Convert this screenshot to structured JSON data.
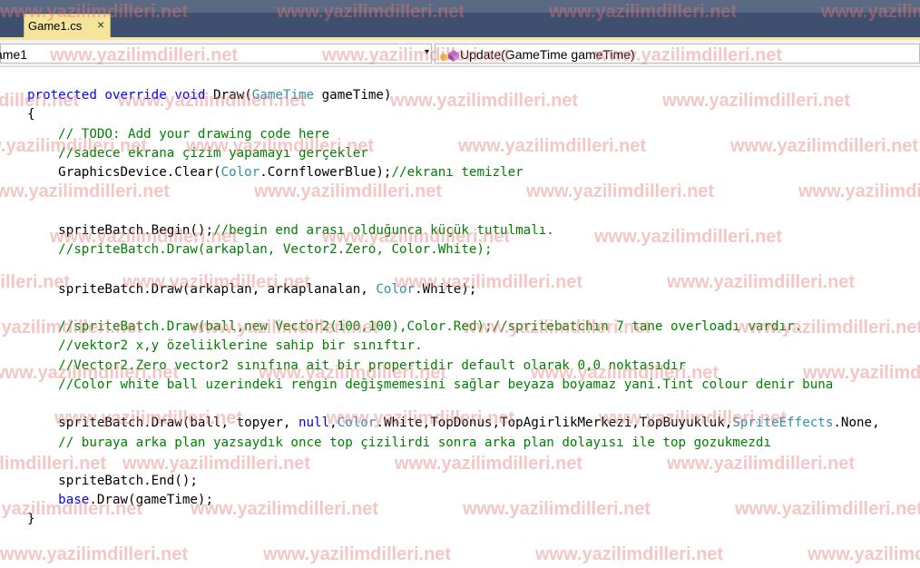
{
  "editor": {
    "tab": {
      "title": "Game1.cs",
      "close": "×"
    },
    "nav": {
      "left_value": "ame1",
      "left_arrow": "▾",
      "right_value": "Update(GameTime gameTime)"
    }
  },
  "code": {
    "l1": {
      "a": "protected",
      "b": " ",
      "c": "override",
      "d": " ",
      "e": "void",
      "f": " Draw(",
      "g": "GameTime",
      "h": " gameTime)"
    },
    "l2": "{",
    "l3": "    // TODO: Add your drawing code here",
    "l4": "    //sadece ekrana çizim yapamayı gerçekler",
    "l5": {
      "a": "    GraphicsDevice.Clear(",
      "b": "Color",
      "c": ".CornflowerBlue);",
      "d": "//ekranı temizler"
    },
    "l6": {
      "a": "    spriteBatch.Begin();",
      "b": "//begin end arası olduğunca küçük tutulmalı."
    },
    "l7": "    //spriteBatch.Draw(arkaplan, Vector2.Zero, Color.White);",
    "l8": {
      "a": "    spriteBatch.Draw(arkaplan, arkaplanalan, ",
      "b": "Color",
      "c": ".White);"
    },
    "l9": "    //spriteBatch.Draw(ball,new Vector2(100,100),Color.Red);//spritebatchın 7 tane overloadı vardır.",
    "l10": "    //vektor2 x,y özeliiklerine sahip bir sınıftır.",
    "l11": "    //Vector2.Zero vector2 sınıfına ait bir propertidir default olarak 0,0 noktasıdır",
    "l12": "    //Color white ball uzerindeki rengin değişmemesini sağlar beyaza boyamaz yani.Tint colour denir buna",
    "l13": {
      "a": "    spriteBatch.Draw(ball, topyer, ",
      "b": "null",
      "c": ",",
      "d": "Color",
      "e": ".White,TopDonus,TopAgirlikMerkezi,TopBuyukluk,",
      "f": "SpriteEffects",
      "g": ".None,"
    },
    "l14": "    // buraya arka plan yazsaydık once top çizilirdi sonra arka plan dolayısı ile top gozukmezdı",
    "l15": "    spriteBatch.End();",
    "l16": {
      "a": "    ",
      "b": "base",
      "c": ".Draw(gameTime);"
    },
    "l17": "}"
  },
  "watermark": "www.yazilimdilleri.net",
  "colors": {
    "keyword": "#0000ff",
    "type": "#2b91af",
    "comment": "#008000",
    "tab": "#f5e49c",
    "watermark": "#e67878"
  }
}
